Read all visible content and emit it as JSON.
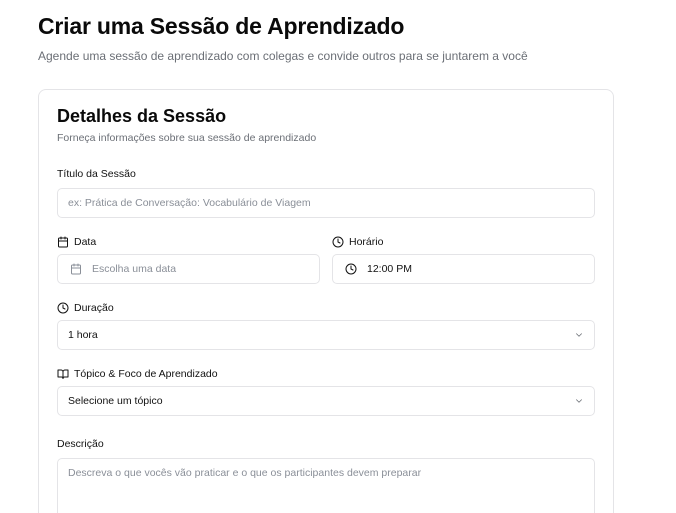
{
  "header": {
    "title": "Criar uma Sessão de Aprendizado",
    "subtitle": "Agende uma sessão de aprendizado com colegas e convide outros para se juntarem a você"
  },
  "card": {
    "title": "Detalhes da Sessão",
    "description": "Forneça informações sobre sua sessão de aprendizado"
  },
  "form": {
    "session_title": {
      "label": "Título da Sessão",
      "placeholder": "ex: Prática de Conversação: Vocabulário de Viagem",
      "value": ""
    },
    "date": {
      "label": "Data",
      "placeholder": "Escolha uma data",
      "icon": "calendar-icon"
    },
    "time": {
      "label": "Horário",
      "value": "12:00 PM",
      "icon": "clock-icon"
    },
    "duration": {
      "label": "Duração",
      "value": "1 hora",
      "icon": "clock-icon"
    },
    "topic": {
      "label": "Tópico & Foco de Aprendizado",
      "value": "Selecione um tópico",
      "icon": "book-open-icon"
    },
    "description": {
      "label": "Descrição",
      "placeholder": "Descreva o que vocês vão praticar e o que os participantes devem preparar"
    }
  }
}
